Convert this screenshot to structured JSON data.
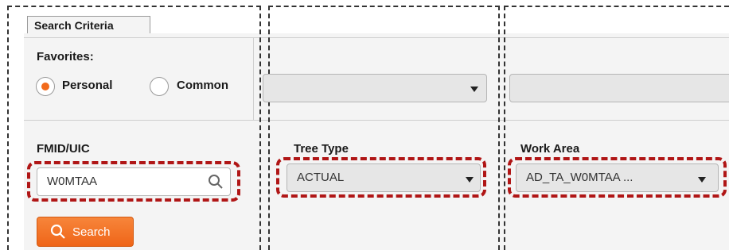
{
  "search_panel": {
    "tab_label": "Search Criteria",
    "favorites": {
      "label": "Favorites:",
      "options": [
        {
          "label": "Personal",
          "checked": true
        },
        {
          "label": "Common",
          "checked": false
        }
      ]
    },
    "fmid_uic": {
      "label": "FMID/UIC",
      "value": "W0MTAA"
    },
    "tree_type": {
      "label": "Tree Type",
      "value": "ACTUAL"
    },
    "work_area": {
      "label": "Work Area",
      "value": "AD_TA_W0MTAA ..."
    },
    "search_button_label": "Search"
  },
  "colors": {
    "accent": "#f26a1b",
    "highlight": "#b01616"
  }
}
